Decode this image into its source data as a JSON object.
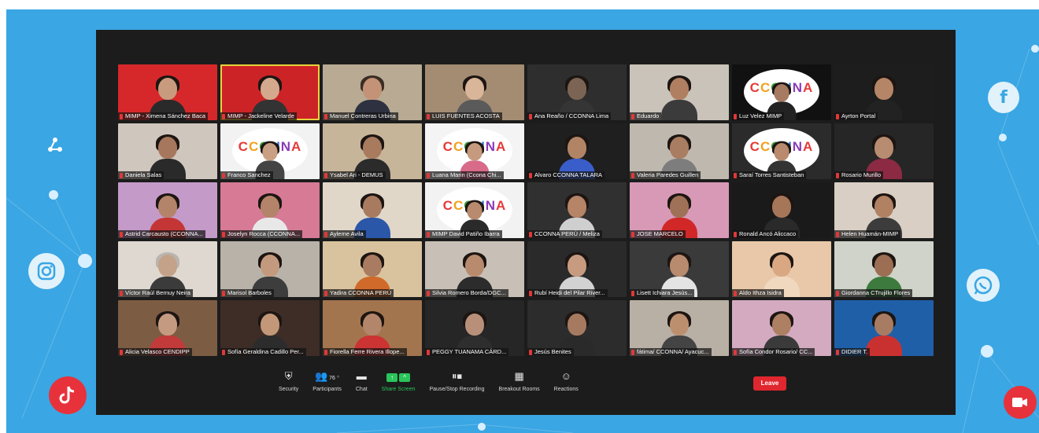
{
  "participants": [
    {
      "name": "MIMP - Ximena Sánchez Baca",
      "bg": "#d6282a",
      "kind": "person",
      "skin": "#c99b7e",
      "shirt": "#2a2a2a"
    },
    {
      "name": "MIMP - Jackeline Velarde",
      "bg": "#cc2327",
      "kind": "person",
      "skin": "#d4a88c",
      "shirt": "#333",
      "active": true
    },
    {
      "name": "Manuel Contreras Urbina",
      "bg": "#b8aa93",
      "kind": "person",
      "skin": "#c49276",
      "shirt": "#2d3140",
      "hairColor": "#3a2d24"
    },
    {
      "name": "LUIS FUENTES ACOSTA",
      "bg": "#a38c72",
      "kind": "person",
      "skin": "#d9b59a",
      "shirt": "#5a5a5a"
    },
    {
      "name": "Ana Reaño / CCONNA Lima",
      "bg": "#2e2e2e",
      "kind": "person",
      "skin": "#7c6455",
      "shirt": "#353535"
    },
    {
      "name": "Eduardo",
      "bg": "#c9c3b9",
      "kind": "person",
      "skin": "#b07f62",
      "shirt": "#3b3b3b"
    },
    {
      "name": "Luz Velez MIMP",
      "bg": "#111111",
      "kind": "logo",
      "logoText": "CCONNA",
      "skin": "#a77a62",
      "shirt": "#222"
    },
    {
      "name": "Ayrton Portal",
      "bg": "#1d1d1d",
      "kind": "person",
      "skin": "#b58567",
      "shirt": "#222"
    },
    {
      "name": "Daniela Salas",
      "bg": "#cfc6bd",
      "kind": "person",
      "skin": "#a6775d",
      "shirt": "#2a2a2a"
    },
    {
      "name": "Franco Sanchez",
      "bg": "#f2f2f2",
      "kind": "logo",
      "logoText": "CCONNA",
      "skin": "#caa085",
      "shirt": "#444"
    },
    {
      "name": "Ysabel Ari - DEMUS",
      "bg": "#c7b59a",
      "kind": "person",
      "skin": "#a87a5e",
      "shirt": "#2b2b2b"
    },
    {
      "name": "Luana Marin (Ccona Chi...",
      "bg": "#f4f4f4",
      "kind": "logo",
      "logoText": "CCONNA",
      "skin": "#c69a7e",
      "shirt": "#d86a8a"
    },
    {
      "name": "Alvaro CCONNA TALARA",
      "bg": "#1f1f1f",
      "kind": "person",
      "skin": "#b28466",
      "shirt": "#3a5ec9"
    },
    {
      "name": "Valeria Paredes Guillen",
      "bg": "#bfb8ae",
      "kind": "person",
      "skin": "#a97d62",
      "shirt": "#7d7d7d"
    },
    {
      "name": "Saraí Torres Santisteban",
      "bg": "#2b2b2b",
      "kind": "logo",
      "logoText": "CCONNA",
      "skin": "#b98a6d",
      "shirt": "#333"
    },
    {
      "name": "Rosario Murillo",
      "bg": "#262626",
      "kind": "person",
      "skin": "#b78c70",
      "shirt": "#8c2a44"
    },
    {
      "name": "Astrid Carcausto (CCONNA...",
      "bg": "#c49ac8",
      "kind": "person",
      "skin": "#b3846a",
      "shirt": "#c43636"
    },
    {
      "name": "Joselyn Rocca (CCONNA...",
      "bg": "#d67a95",
      "kind": "person",
      "skin": "#b3846a",
      "shirt": "#e8e8e8"
    },
    {
      "name": "Ayleme Avila",
      "bg": "#e0d7c9",
      "kind": "person",
      "skin": "#a87b60",
      "shirt": "#2b57a8"
    },
    {
      "name": "MIMP David Patiño Ibarra",
      "bg": "#f2f2f2",
      "kind": "logo",
      "logoText": "CCONNA",
      "skin": "#b88b6f",
      "shirt": "#2a2a2a"
    },
    {
      "name": "CCONNA PERÚ / Meliza",
      "bg": "#303030",
      "kind": "person",
      "skin": "#b68466",
      "shirt": "#cfcfcf"
    },
    {
      "name": "JOSE MARCELO",
      "bg": "#d799b6",
      "kind": "person",
      "skin": "#9f7157",
      "shirt": "#d22727"
    },
    {
      "name": "Ronald Ancó Aliccaco",
      "bg": "#1a1a1a",
      "kind": "person",
      "skin": "#a67659",
      "shirt": "#2a2a2a"
    },
    {
      "name": "Helen Huamán-MIMP",
      "bg": "#d9cfc4",
      "kind": "person",
      "skin": "#b08163",
      "shirt": "#3c3c3c"
    },
    {
      "name": "Víctor Raúl Bernuy Neira",
      "bg": "#ded8d0",
      "kind": "person",
      "skin": "#c4a289",
      "shirt": "#3b3b3b",
      "hairColor": "#b9b4ae"
    },
    {
      "name": "Marisol Barboles",
      "bg": "#b9b2a8",
      "kind": "person",
      "skin": "#c49a7e",
      "shirt": "#3d3d3d"
    },
    {
      "name": "Yadira CCONNA PERÚ",
      "bg": "#d8c39e",
      "kind": "person",
      "skin": "#a97b60",
      "shirt": "#d06a2a"
    },
    {
      "name": "Silvia Romero Borda/DGC...",
      "bg": "#c8c0b6",
      "kind": "person",
      "skin": "#b88b6e",
      "shirt": "#2c2c2c"
    },
    {
      "name": "Rubí Heidi del Pilar River...",
      "bg": "#2a2a2a",
      "kind": "person",
      "skin": "#c79b80",
      "shirt": "#d2d2d2"
    },
    {
      "name": "Lisett Ichiara Jesús...",
      "bg": "#3a3a3a",
      "kind": "person",
      "skin": "#b88a6e",
      "shirt": "#e4e4e4"
    },
    {
      "name": "Aldo Ithza Isidra",
      "bg": "#e8c8a8",
      "kind": "person",
      "skin": "#d9a883",
      "shirt": "#f0d8bf"
    },
    {
      "name": "Giordanna CTrujillo Flores",
      "bg": "#cfd3c9",
      "kind": "person",
      "skin": "#9c6e54",
      "shirt": "#3d7a3d"
    },
    {
      "name": "Alicia Velasco CENDIPP",
      "bg": "#7d5c44",
      "kind": "person",
      "skin": "#c49b80",
      "shirt": "#c23a3a"
    },
    {
      "name": "Sofía Geraldina Cadillo Per...",
      "bg": "#3d2d26",
      "kind": "person",
      "skin": "#c29878",
      "shirt": "#2c2c2c"
    },
    {
      "name": "Fiorella Ferre Rivera Illope...",
      "bg": "#a3754e",
      "kind": "person",
      "skin": "#b3856a",
      "shirt": "#cc3333"
    },
    {
      "name": "PEGGY TUANAMA CÁRD...",
      "bg": "#262626",
      "kind": "person",
      "skin": "#b8907a",
      "shirt": "#2e2e2e"
    },
    {
      "name": "Jesús Benites",
      "bg": "#2c2c2c",
      "kind": "person",
      "skin": "#a57a61",
      "shirt": "#2a2a2a"
    },
    {
      "name": "fátima/ CCONNA/ Ayacuc...",
      "bg": "#b9b0a5",
      "kind": "person",
      "skin": "#bc906f",
      "shirt": "#444"
    },
    {
      "name": "Sofía Condor Rosario/ CC...",
      "bg": "#d3aac0",
      "kind": "person",
      "skin": "#ad7f63",
      "shirt": "#3a3a3a"
    },
    {
      "name": "DIDIER T.",
      "bg": "#1f5fa8",
      "kind": "person",
      "skin": "#a87c63",
      "shirt": "#c93131"
    }
  ],
  "toolbar": {
    "security": "Security",
    "participants": "Participants",
    "participants_count": "76",
    "chat": "Chat",
    "share_screen": "Share Screen",
    "pause_stop_recording": "Pause/Stop Recording",
    "breakout_rooms": "Breakout Rooms",
    "reactions": "Reactions",
    "leave": "Leave"
  },
  "colors": {
    "frame_blue": "#3aa6e3",
    "zoom_bg": "#1c1c1c",
    "share_green": "#29c55a",
    "leave_red": "#e0262e",
    "active_speaker": "#e8d23a"
  },
  "social_icons": [
    "share-icon",
    "instagram-icon",
    "tiktok-icon",
    "facebook-icon",
    "whatsapp-icon",
    "video-camera-icon"
  ]
}
